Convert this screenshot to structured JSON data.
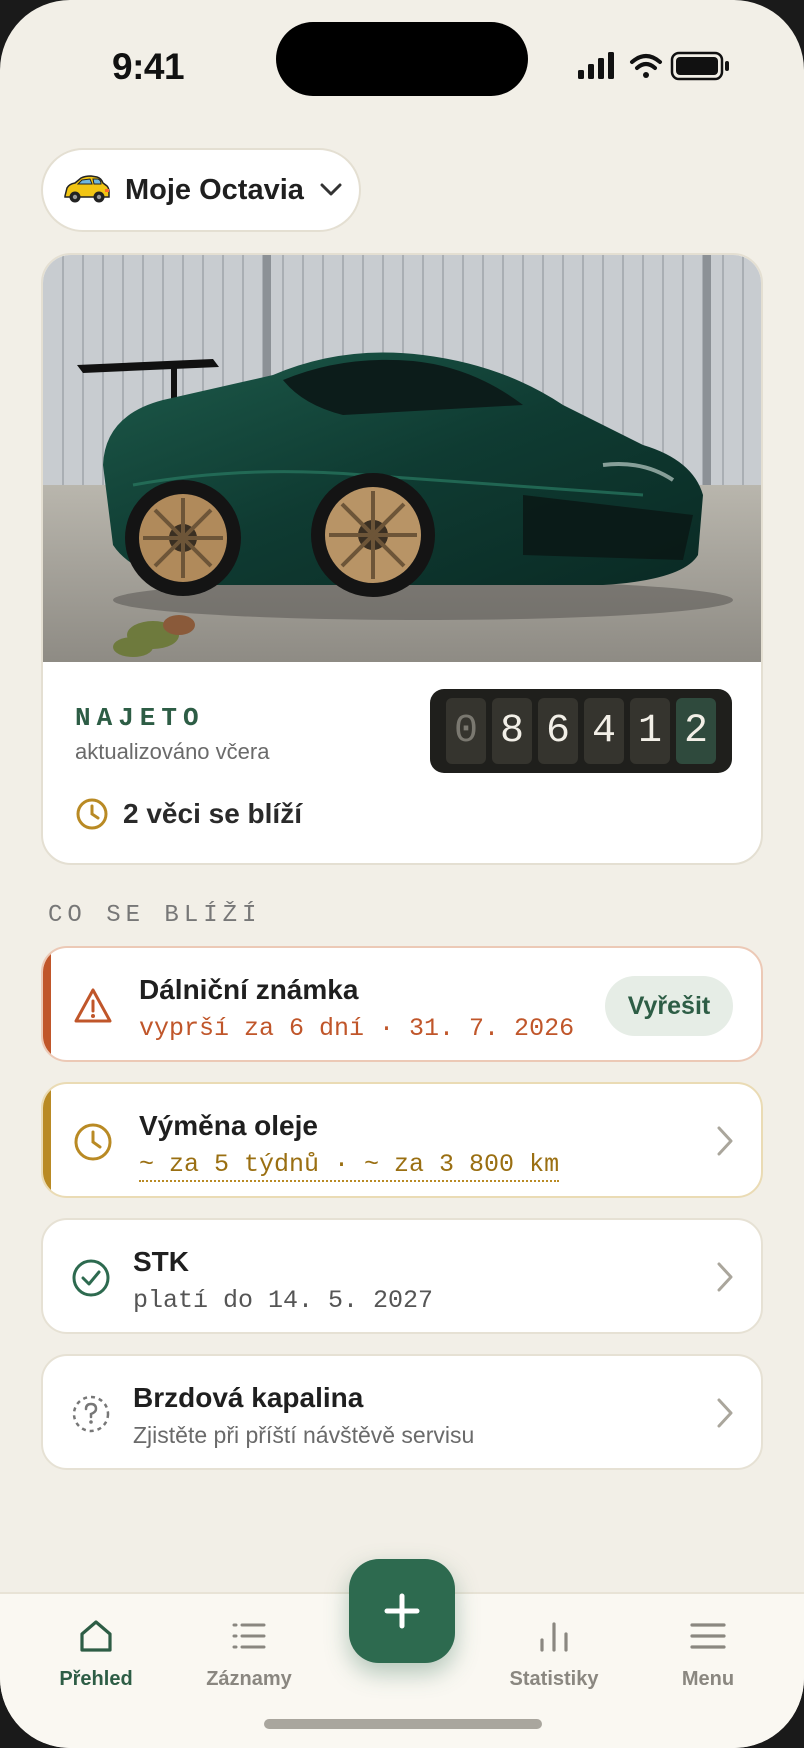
{
  "status_bar": {
    "time": "9:41"
  },
  "car_selector": {
    "name": "Moje Octavia",
    "icon": "car-emoji-icon"
  },
  "hero": {
    "mileage_label": "NAJETO",
    "updated_text": "aktualizováno včera",
    "odometer_digits": [
      "0",
      "8",
      "6",
      "4",
      "1",
      "2"
    ],
    "upcoming_text": "2 věci se blíží"
  },
  "section": {
    "title": "CO SE BLÍŽÍ"
  },
  "items": [
    {
      "title": "Dálniční známka",
      "subtitle": "vyprší za 6 dní · 31. 7. 2026",
      "action_label": "Vyřešit",
      "icon": "warning-icon",
      "accent": "#c0562a"
    },
    {
      "title": "Výměna oleje",
      "subtitle": "~ za 5 týdnů · ~ za 3 800 km",
      "icon": "clock-icon",
      "accent": "#b98a24"
    },
    {
      "title": "STK",
      "subtitle": "platí do 14. 5. 2027",
      "icon": "check-circle-icon",
      "accent": "#2d6a4f"
    },
    {
      "title": "Brzdová kapalina",
      "subtitle": "Zjistěte při příští návštěvě servisu",
      "icon": "question-circle-icon",
      "accent": "#777777"
    }
  ],
  "tabbar": {
    "tabs": [
      {
        "label": "Přehled",
        "icon": "home-icon",
        "active": true
      },
      {
        "label": "Záznamy",
        "icon": "list-icon",
        "active": false
      },
      {
        "label": "Statistiky",
        "icon": "bar-chart-icon",
        "active": false
      },
      {
        "label": "Menu",
        "icon": "hamburger-icon",
        "active": false
      }
    ],
    "fab_icon": "plus-icon"
  },
  "colors": {
    "background": "#f2efe7",
    "primary": "#2d6a4f",
    "danger": "#c0562a",
    "warning": "#b98a24"
  }
}
